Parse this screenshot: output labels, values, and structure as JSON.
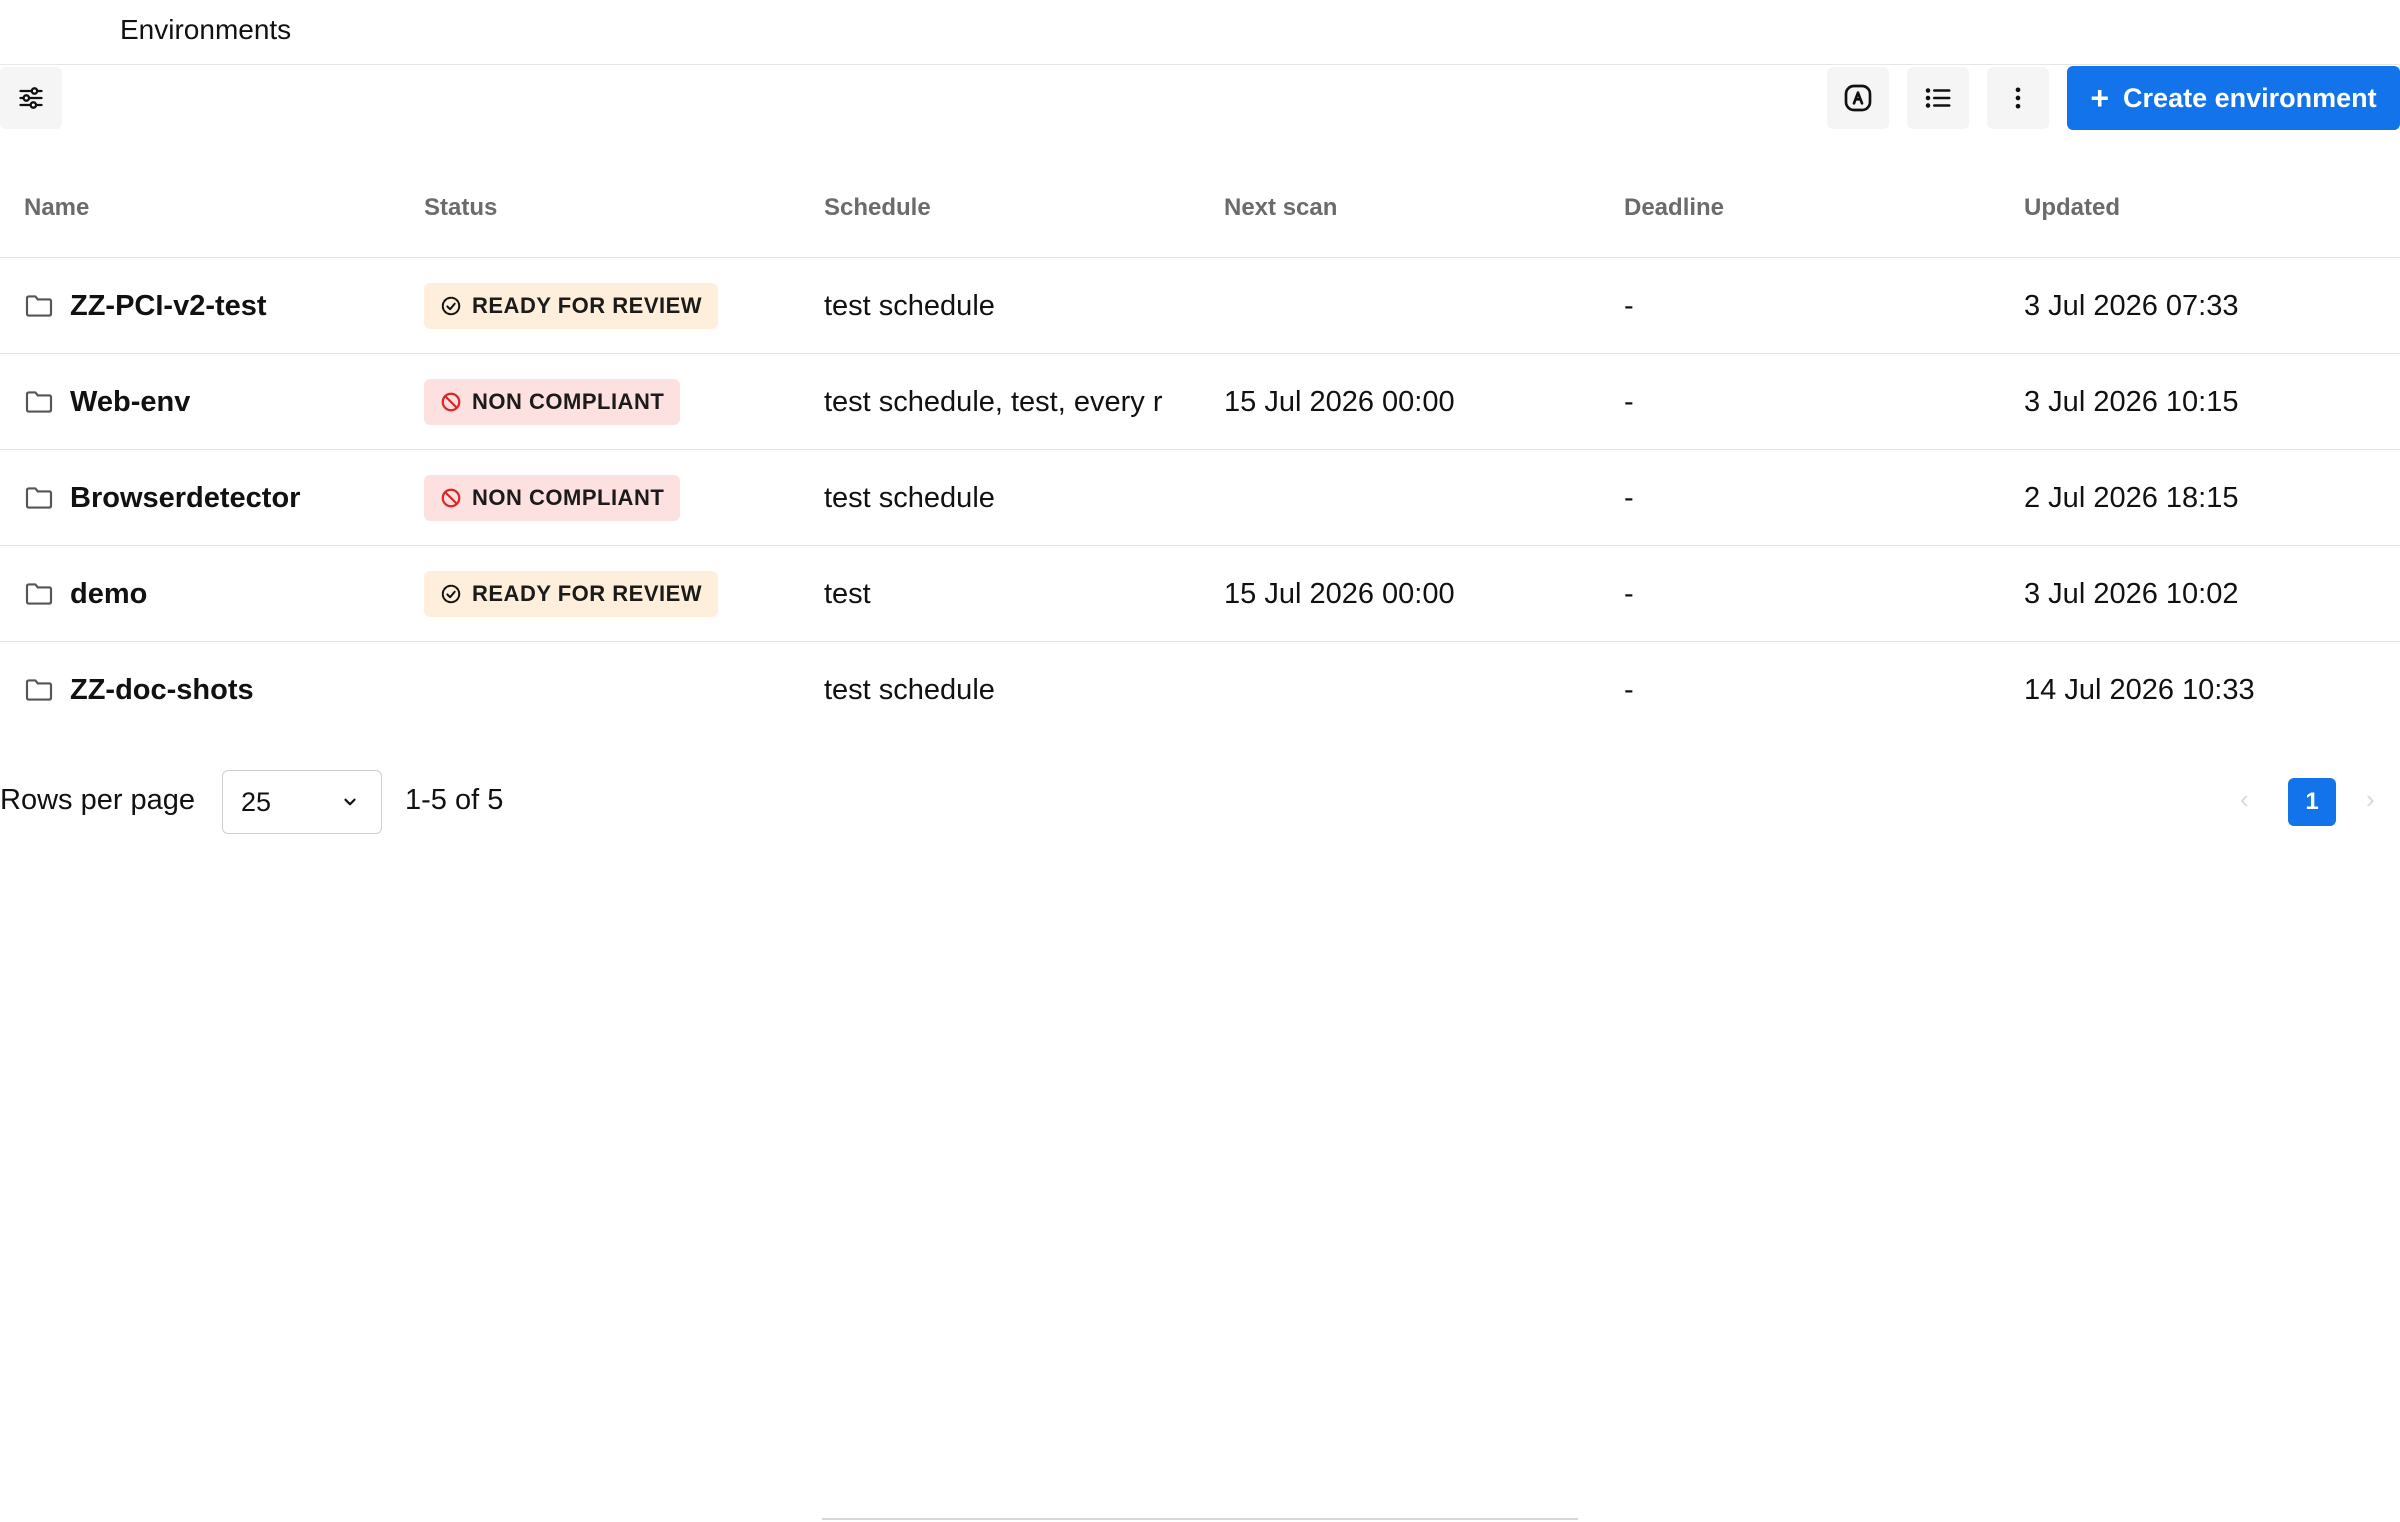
{
  "header": {
    "title": "Environments"
  },
  "toolbar": {
    "filter_icon": "sliders-icon",
    "view_icons": [
      "auto-badge-icon",
      "list-icon",
      "more-vertical-icon"
    ],
    "create_label": "Create environment",
    "accent_color": "#1273eb"
  },
  "table": {
    "columns": {
      "name": "Name",
      "status": "Status",
      "schedule": "Schedule",
      "next_scan": "Next scan",
      "deadline": "Deadline",
      "updated": "Updated"
    },
    "rows": [
      {
        "name": "ZZ-PCI-v2-test",
        "status": "READY FOR REVIEW",
        "status_type": "review",
        "schedule": "test schedule",
        "next_scan": "",
        "deadline": "-",
        "updated": "3 Jul 2026 07:33"
      },
      {
        "name": "Web-env",
        "status": "NON COMPLIANT",
        "status_type": "noncompliant",
        "schedule": "test schedule, test, every r",
        "next_scan": "15 Jul 2026 00:00",
        "deadline": "-",
        "updated": "3 Jul 2026 10:15"
      },
      {
        "name": "Browserdetector",
        "status": "NON COMPLIANT",
        "status_type": "noncompliant",
        "schedule": "test schedule",
        "next_scan": "",
        "deadline": "-",
        "updated": "2 Jul 2026 18:15"
      },
      {
        "name": "demo",
        "status": "READY FOR REVIEW",
        "status_type": "review",
        "schedule": "test",
        "next_scan": "15 Jul 2026 00:00",
        "deadline": "-",
        "updated": "3 Jul 2026 10:02"
      },
      {
        "name": "ZZ-doc-shots",
        "status": "",
        "status_type": "none",
        "schedule": "test schedule",
        "next_scan": "",
        "deadline": "-",
        "updated": "14 Jul 2026 10:33"
      }
    ]
  },
  "pagination": {
    "rows_per_page_label": "Rows per page",
    "rows_per_page_value": "25",
    "range": "1-5 of 5",
    "current_page": "1"
  }
}
